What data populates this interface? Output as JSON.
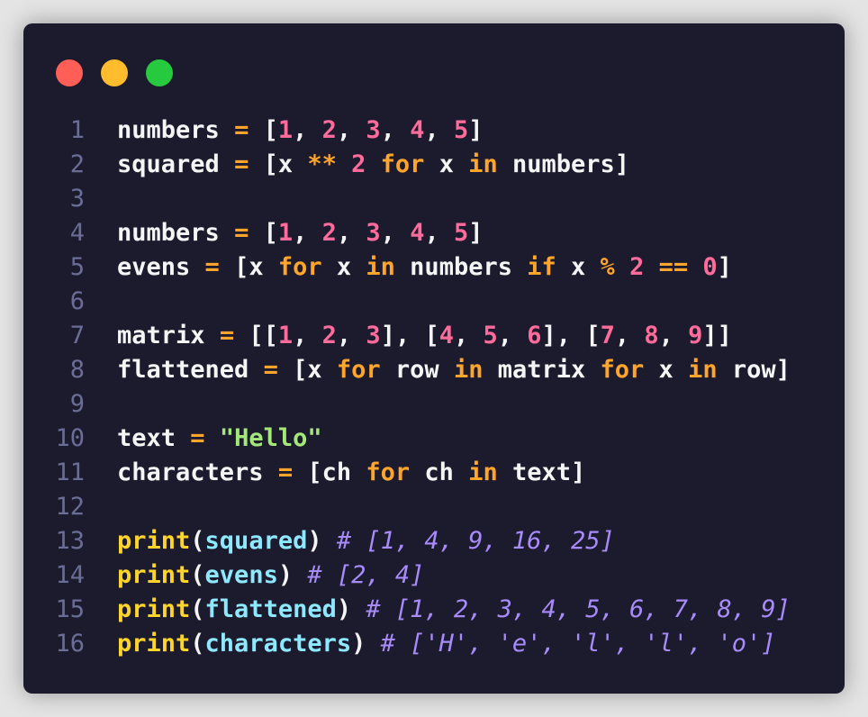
{
  "window": {
    "buttons": [
      {
        "name": "close-button",
        "color": "#ff5f56"
      },
      {
        "name": "minimize-button",
        "color": "#ffbd2e"
      },
      {
        "name": "maximize-button",
        "color": "#27c93f"
      }
    ]
  },
  "code": {
    "language": "python",
    "lines": [
      {
        "num": "1",
        "tokens": [
          {
            "t": "numbers",
            "c": "def"
          },
          {
            "t": " ",
            "c": "def"
          },
          {
            "t": "=",
            "c": "op"
          },
          {
            "t": " [",
            "c": "def"
          },
          {
            "t": "1",
            "c": "num"
          },
          {
            "t": ", ",
            "c": "def"
          },
          {
            "t": "2",
            "c": "num"
          },
          {
            "t": ", ",
            "c": "def"
          },
          {
            "t": "3",
            "c": "num"
          },
          {
            "t": ", ",
            "c": "def"
          },
          {
            "t": "4",
            "c": "num"
          },
          {
            "t": ", ",
            "c": "def"
          },
          {
            "t": "5",
            "c": "num"
          },
          {
            "t": "]",
            "c": "def"
          }
        ]
      },
      {
        "num": "2",
        "tokens": [
          {
            "t": "squared",
            "c": "def"
          },
          {
            "t": " ",
            "c": "def"
          },
          {
            "t": "=",
            "c": "op"
          },
          {
            "t": " [x ",
            "c": "def"
          },
          {
            "t": "**",
            "c": "op"
          },
          {
            "t": " ",
            "c": "def"
          },
          {
            "t": "2",
            "c": "num"
          },
          {
            "t": " ",
            "c": "def"
          },
          {
            "t": "for",
            "c": "kw"
          },
          {
            "t": " x ",
            "c": "def"
          },
          {
            "t": "in",
            "c": "kw"
          },
          {
            "t": " numbers]",
            "c": "def"
          }
        ]
      },
      {
        "num": "3",
        "tokens": []
      },
      {
        "num": "4",
        "tokens": [
          {
            "t": "numbers",
            "c": "def"
          },
          {
            "t": " ",
            "c": "def"
          },
          {
            "t": "=",
            "c": "op"
          },
          {
            "t": " [",
            "c": "def"
          },
          {
            "t": "1",
            "c": "num"
          },
          {
            "t": ", ",
            "c": "def"
          },
          {
            "t": "2",
            "c": "num"
          },
          {
            "t": ", ",
            "c": "def"
          },
          {
            "t": "3",
            "c": "num"
          },
          {
            "t": ", ",
            "c": "def"
          },
          {
            "t": "4",
            "c": "num"
          },
          {
            "t": ", ",
            "c": "def"
          },
          {
            "t": "5",
            "c": "num"
          },
          {
            "t": "]",
            "c": "def"
          }
        ]
      },
      {
        "num": "5",
        "tokens": [
          {
            "t": "evens",
            "c": "def"
          },
          {
            "t": " ",
            "c": "def"
          },
          {
            "t": "=",
            "c": "op"
          },
          {
            "t": " [x ",
            "c": "def"
          },
          {
            "t": "for",
            "c": "kw"
          },
          {
            "t": " x ",
            "c": "def"
          },
          {
            "t": "in",
            "c": "kw"
          },
          {
            "t": " numbers ",
            "c": "def"
          },
          {
            "t": "if",
            "c": "kw"
          },
          {
            "t": " x ",
            "c": "def"
          },
          {
            "t": "%",
            "c": "op"
          },
          {
            "t": " ",
            "c": "def"
          },
          {
            "t": "2",
            "c": "num"
          },
          {
            "t": " ",
            "c": "def"
          },
          {
            "t": "==",
            "c": "op"
          },
          {
            "t": " ",
            "c": "def"
          },
          {
            "t": "0",
            "c": "num"
          },
          {
            "t": "]",
            "c": "def"
          }
        ]
      },
      {
        "num": "6",
        "tokens": []
      },
      {
        "num": "7",
        "tokens": [
          {
            "t": "matrix",
            "c": "def"
          },
          {
            "t": " ",
            "c": "def"
          },
          {
            "t": "=",
            "c": "op"
          },
          {
            "t": " [[",
            "c": "def"
          },
          {
            "t": "1",
            "c": "num"
          },
          {
            "t": ", ",
            "c": "def"
          },
          {
            "t": "2",
            "c": "num"
          },
          {
            "t": ", ",
            "c": "def"
          },
          {
            "t": "3",
            "c": "num"
          },
          {
            "t": "], [",
            "c": "def"
          },
          {
            "t": "4",
            "c": "num"
          },
          {
            "t": ", ",
            "c": "def"
          },
          {
            "t": "5",
            "c": "num"
          },
          {
            "t": ", ",
            "c": "def"
          },
          {
            "t": "6",
            "c": "num"
          },
          {
            "t": "], [",
            "c": "def"
          },
          {
            "t": "7",
            "c": "num"
          },
          {
            "t": ", ",
            "c": "def"
          },
          {
            "t": "8",
            "c": "num"
          },
          {
            "t": ", ",
            "c": "def"
          },
          {
            "t": "9",
            "c": "num"
          },
          {
            "t": "]]",
            "c": "def"
          }
        ]
      },
      {
        "num": "8",
        "tokens": [
          {
            "t": "flattened",
            "c": "def"
          },
          {
            "t": " ",
            "c": "def"
          },
          {
            "t": "=",
            "c": "op"
          },
          {
            "t": " [x ",
            "c": "def"
          },
          {
            "t": "for",
            "c": "kw"
          },
          {
            "t": " row ",
            "c": "def"
          },
          {
            "t": "in",
            "c": "kw"
          },
          {
            "t": " matrix ",
            "c": "def"
          },
          {
            "t": "for",
            "c": "kw"
          },
          {
            "t": " x ",
            "c": "def"
          },
          {
            "t": "in",
            "c": "kw"
          },
          {
            "t": " row]",
            "c": "def"
          }
        ]
      },
      {
        "num": "9",
        "tokens": []
      },
      {
        "num": "10",
        "tokens": [
          {
            "t": "text",
            "c": "def"
          },
          {
            "t": " ",
            "c": "def"
          },
          {
            "t": "=",
            "c": "op"
          },
          {
            "t": " ",
            "c": "def"
          },
          {
            "t": "\"Hello\"",
            "c": "str"
          }
        ]
      },
      {
        "num": "11",
        "tokens": [
          {
            "t": "characters",
            "c": "def"
          },
          {
            "t": " ",
            "c": "def"
          },
          {
            "t": "=",
            "c": "op"
          },
          {
            "t": " [ch ",
            "c": "def"
          },
          {
            "t": "for",
            "c": "kw"
          },
          {
            "t": " ch ",
            "c": "def"
          },
          {
            "t": "in",
            "c": "kw"
          },
          {
            "t": " text]",
            "c": "def"
          }
        ]
      },
      {
        "num": "12",
        "tokens": []
      },
      {
        "num": "13",
        "tokens": [
          {
            "t": "print",
            "c": "fn"
          },
          {
            "t": "(",
            "c": "def"
          },
          {
            "t": "squared",
            "c": "arg"
          },
          {
            "t": ") ",
            "c": "def"
          },
          {
            "t": "# [1, 4, 9, 16, 25]",
            "c": "com"
          }
        ]
      },
      {
        "num": "14",
        "tokens": [
          {
            "t": "print",
            "c": "fn"
          },
          {
            "t": "(",
            "c": "def"
          },
          {
            "t": "evens",
            "c": "arg"
          },
          {
            "t": ") ",
            "c": "def"
          },
          {
            "t": "# [2, 4]",
            "c": "com"
          }
        ]
      },
      {
        "num": "15",
        "tokens": [
          {
            "t": "print",
            "c": "fn"
          },
          {
            "t": "(",
            "c": "def"
          },
          {
            "t": "flattened",
            "c": "arg"
          },
          {
            "t": ") ",
            "c": "def"
          },
          {
            "t": "# [1, 2, 3, 4, 5, 6, 7, 8, 9]",
            "c": "com"
          }
        ]
      },
      {
        "num": "16",
        "tokens": [
          {
            "t": "print",
            "c": "fn"
          },
          {
            "t": "(",
            "c": "def"
          },
          {
            "t": "characters",
            "c": "arg"
          },
          {
            "t": ") ",
            "c": "def"
          },
          {
            "t": "# ['H', 'e', 'l', 'l', 'o']",
            "c": "com"
          }
        ]
      }
    ]
  }
}
